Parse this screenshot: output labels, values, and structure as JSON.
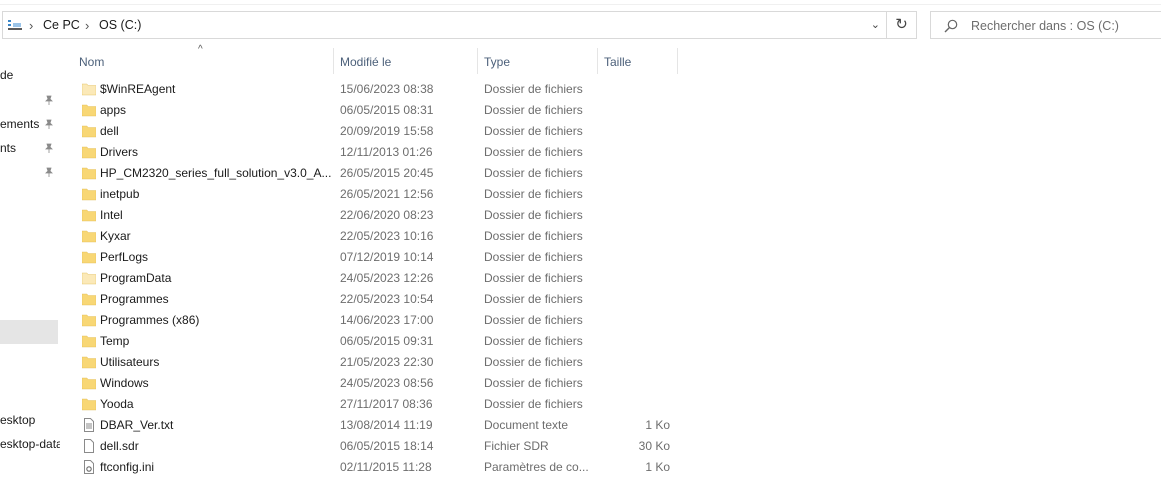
{
  "address_bar": {
    "crumbs": [
      "Ce PC",
      "OS (C:)"
    ],
    "dropdown_glyph": "⌄",
    "refresh_glyph": "↻"
  },
  "search": {
    "placeholder": "Rechercher dans : OS (C:)"
  },
  "nav": {
    "items": [
      {
        "label": "de",
        "pinned": false
      },
      {
        "label": "",
        "pinned": true
      },
      {
        "label": "ements",
        "pinned": true
      },
      {
        "label": "nts",
        "pinned": true
      },
      {
        "label": "",
        "pinned": true
      },
      {
        "label": "esktop",
        "pinned": false
      },
      {
        "label": "esktop-data",
        "pinned": false
      }
    ]
  },
  "columns": {
    "name": "Nom",
    "modified": "Modifié le",
    "type": "Type",
    "size": "Taille"
  },
  "files": [
    {
      "name": "$WinREAgent",
      "modified": "15/06/2023 08:38",
      "type": "Dossier de fichiers",
      "size": "",
      "icon": "folder-hidden"
    },
    {
      "name": "apps",
      "modified": "06/05/2015 08:31",
      "type": "Dossier de fichiers",
      "size": "",
      "icon": "folder"
    },
    {
      "name": "dell",
      "modified": "20/09/2019 15:58",
      "type": "Dossier de fichiers",
      "size": "",
      "icon": "folder"
    },
    {
      "name": "Drivers",
      "modified": "12/11/2013 01:26",
      "type": "Dossier de fichiers",
      "size": "",
      "icon": "folder"
    },
    {
      "name": "HP_CM2320_series_full_solution_v3.0_A...",
      "modified": "26/05/2015 20:45",
      "type": "Dossier de fichiers",
      "size": "",
      "icon": "folder"
    },
    {
      "name": "inetpub",
      "modified": "26/05/2021 12:56",
      "type": "Dossier de fichiers",
      "size": "",
      "icon": "folder"
    },
    {
      "name": "Intel",
      "modified": "22/06/2020 08:23",
      "type": "Dossier de fichiers",
      "size": "",
      "icon": "folder"
    },
    {
      "name": "Kyxar",
      "modified": "22/05/2023 10:16",
      "type": "Dossier de fichiers",
      "size": "",
      "icon": "folder"
    },
    {
      "name": "PerfLogs",
      "modified": "07/12/2019 10:14",
      "type": "Dossier de fichiers",
      "size": "",
      "icon": "folder"
    },
    {
      "name": "ProgramData",
      "modified": "24/05/2023 12:26",
      "type": "Dossier de fichiers",
      "size": "",
      "icon": "folder-hidden"
    },
    {
      "name": "Programmes",
      "modified": "22/05/2023 10:54",
      "type": "Dossier de fichiers",
      "size": "",
      "icon": "folder"
    },
    {
      "name": "Programmes (x86)",
      "modified": "14/06/2023 17:00",
      "type": "Dossier de fichiers",
      "size": "",
      "icon": "folder"
    },
    {
      "name": "Temp",
      "modified": "06/05/2015 09:31",
      "type": "Dossier de fichiers",
      "size": "",
      "icon": "folder"
    },
    {
      "name": "Utilisateurs",
      "modified": "21/05/2023 22:30",
      "type": "Dossier de fichiers",
      "size": "",
      "icon": "folder"
    },
    {
      "name": "Windows",
      "modified": "24/05/2023 08:56",
      "type": "Dossier de fichiers",
      "size": "",
      "icon": "folder"
    },
    {
      "name": "Yooda",
      "modified": "27/11/2017 08:36",
      "type": "Dossier de fichiers",
      "size": "",
      "icon": "folder"
    },
    {
      "name": "DBAR_Ver.txt",
      "modified": "13/08/2014 11:19",
      "type": "Document texte",
      "size": "1 Ko",
      "icon": "text-file"
    },
    {
      "name": "dell.sdr",
      "modified": "06/05/2015 18:14",
      "type": "Fichier SDR",
      "size": "30 Ko",
      "icon": "file"
    },
    {
      "name": "ftconfig.ini",
      "modified": "02/11/2015 11:28",
      "type": "Paramètres de co...",
      "size": "1 Ko",
      "icon": "settings-file"
    }
  ],
  "colors": {
    "folder": "#f8d775",
    "folder_hidden": "#fbe9b8",
    "header_text": "#4c607a",
    "meta_text": "#6d6d6d",
    "nav_selected": "#e5e5e5"
  }
}
